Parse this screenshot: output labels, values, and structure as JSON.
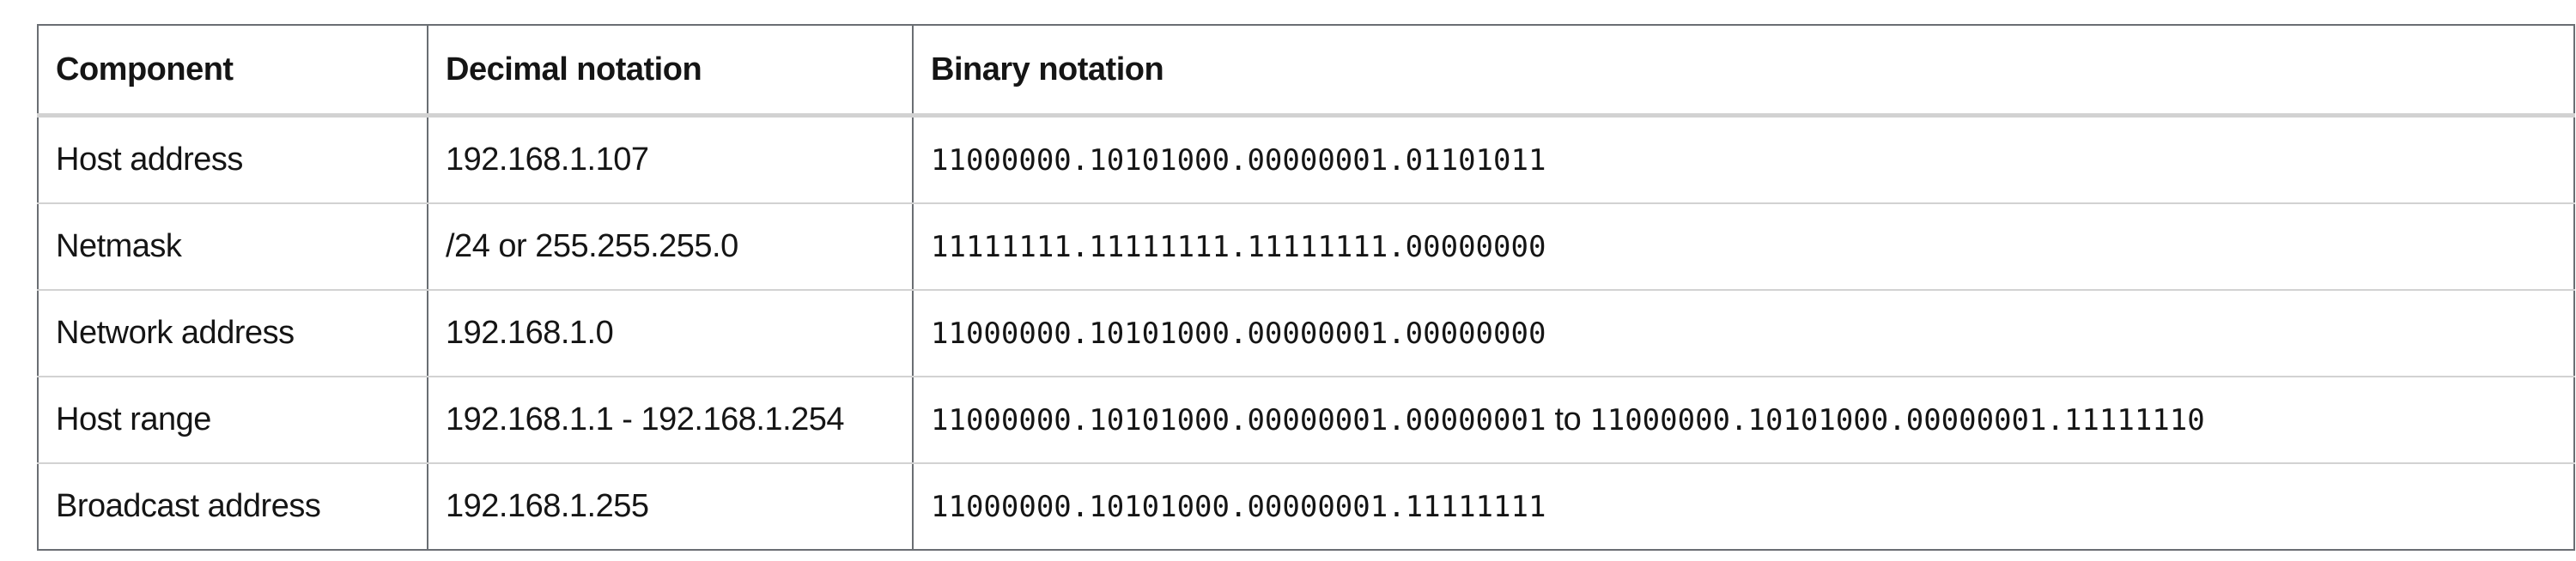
{
  "table": {
    "headers": [
      "Component",
      "Decimal notation",
      "Binary notation"
    ],
    "rows": [
      {
        "component": "Host address",
        "decimal": "192.168.1.107",
        "binary": "11000000.10101000.00000001.01101011"
      },
      {
        "component": "Netmask",
        "decimal": "/24 or 255.255.255.0",
        "binary": "11111111.11111111.11111111.00000000"
      },
      {
        "component": "Network address",
        "decimal": "192.168.1.0",
        "binary": "11000000.10101000.00000001.00000000"
      },
      {
        "component": "Host range",
        "decimal": "192.168.1.1 - 192.168.1.254",
        "binary": "11000000.10101000.00000001.00000001",
        "binary_joiner": " to ",
        "binary_end": "11000000.10101000.00000001.11111110"
      },
      {
        "component": "Broadcast address",
        "decimal": "192.168.1.255",
        "binary": "11000000.10101000.00000001.11111111"
      }
    ]
  }
}
